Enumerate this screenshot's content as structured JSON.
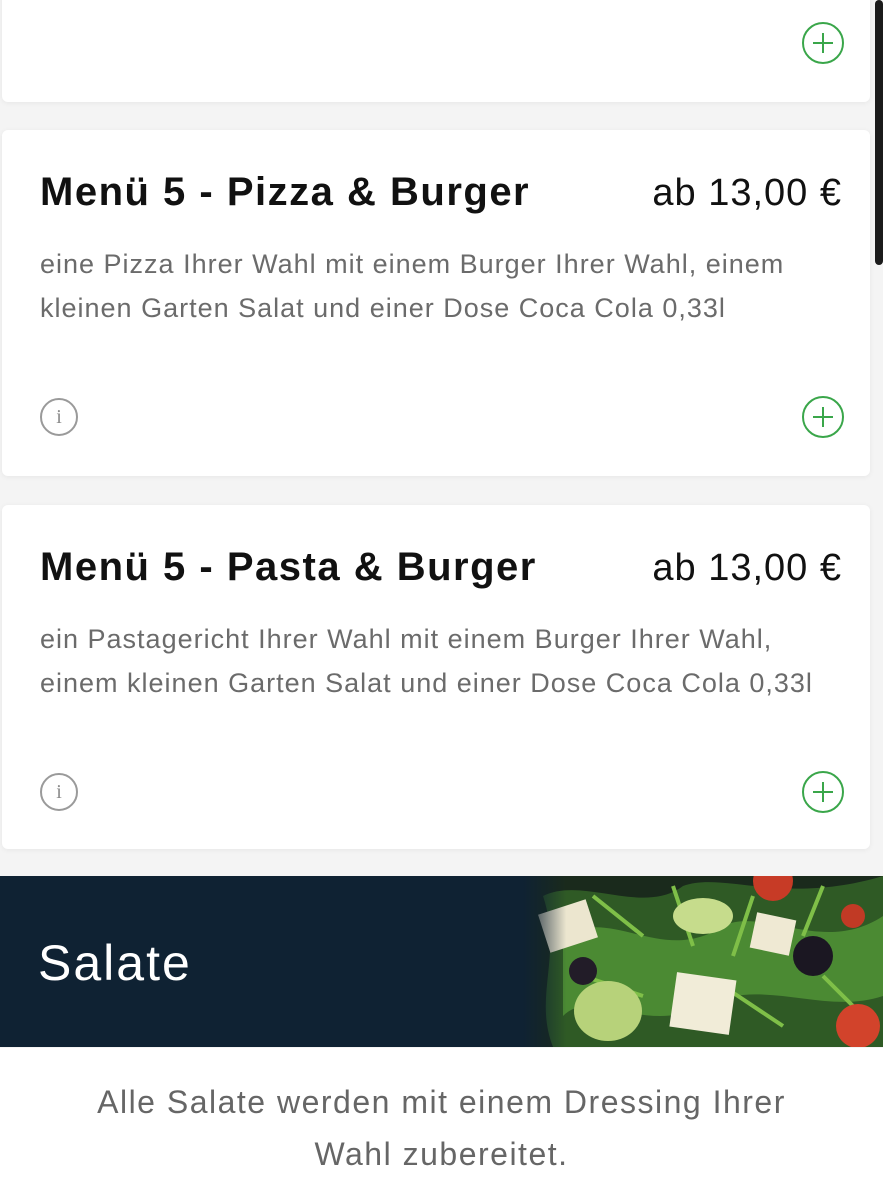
{
  "colors": {
    "accent_green": "#3aa64a",
    "banner_bg": "#0f2233",
    "description_gray": "#6b6b6b"
  },
  "items": [
    {
      "title": "Menü 5 - Pizza & Burger",
      "price": "ab 13,00 €",
      "description": "eine Pizza Ihrer Wahl mit einem Burger Ihrer Wahl, einem kleinen Garten Salat und einer Dose Coca Cola 0,33l",
      "info_icon": "info-icon",
      "add_icon": "plus-circle-icon"
    },
    {
      "title": "Menü 5 - Pasta & Burger",
      "price": "ab 13,00 €",
      "description": "ein Pastagericht Ihrer Wahl mit einem Burger Ihrer Wahl, einem kleinen Garten Salat und einer Dose Coca Cola 0,33l",
      "info_icon": "info-icon",
      "add_icon": "plus-circle-icon"
    }
  ],
  "info_glyph": "i",
  "section": {
    "title": "Salate",
    "note": "Alle Salate werden mit einem Dressing Ihrer Wahl zubereitet.",
    "image": "salad-photo"
  }
}
